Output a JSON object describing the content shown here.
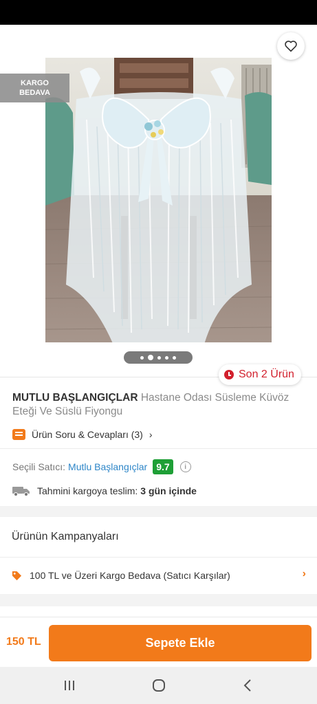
{
  "header": {
    "back_icon": "arrow-left-icon",
    "share_icon": "share-icon",
    "favorite_icon": "heart-outline-icon"
  },
  "badge": {
    "line1": "KARGO",
    "line2": "BEDAVA"
  },
  "gallery": {
    "total_images": 5,
    "active_index": 1
  },
  "stock": {
    "label": "Son 2 Ürün",
    "icon": "clock-icon",
    "color": "#d2202d"
  },
  "product": {
    "brand": "MUTLU BAŞLANGIÇLAR",
    "name": "Hastane Odası Süsleme Küvöz Eteği Ve Süslü Fiyongu",
    "qa_label": "Ürün Soru & Cevapları (3)"
  },
  "seller": {
    "label": "Seçili Satıcı:",
    "name": "Mutlu Başlangıçlar",
    "score": "9.7"
  },
  "delivery": {
    "label": "Tahmini kargoya teslim:",
    "value": "3 gün içinde"
  },
  "campaigns": {
    "title": "Ürünün Kampanyaları",
    "items": [
      {
        "label": "100 TL ve Üzeri Kargo Bedava (Satıcı Karşılar)",
        "icon": "tag-icon"
      }
    ]
  },
  "footer": {
    "price": "150 TL",
    "add_to_cart": "Sepete Ekle"
  },
  "colors": {
    "accent": "#f27a1a",
    "seller_link": "#2e86c8",
    "score_bg": "#1e9f36"
  }
}
